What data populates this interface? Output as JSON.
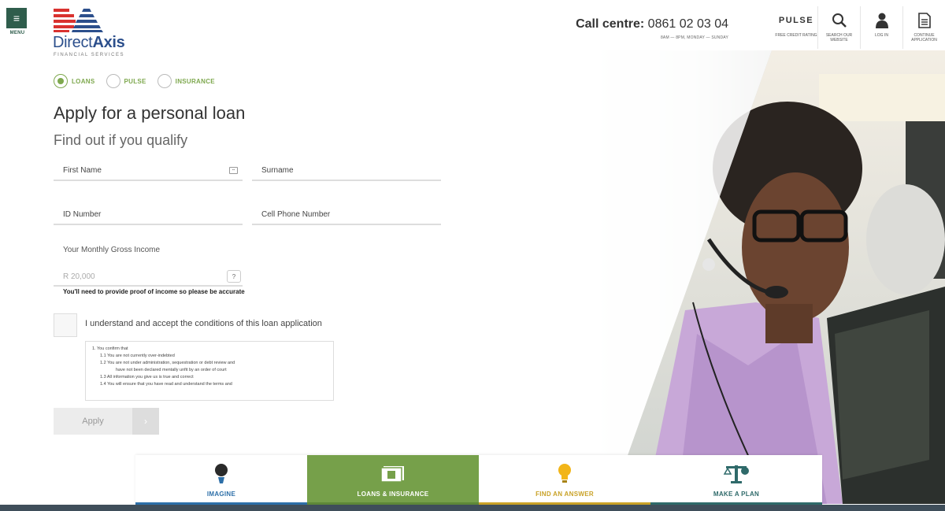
{
  "header": {
    "menu_label": "MENU",
    "logo_name_light": "Direct",
    "logo_name_bold": "Axis",
    "logo_sub": "FINANCIAL SERVICES",
    "call_centre_label": "Call centre:",
    "call_centre_number": "0861 02 03 04",
    "call_centre_hours": "8AM — 8PM, MONDAY — SUNDAY",
    "nav": [
      {
        "name": "pulse",
        "label": "FREE CREDIT RATING",
        "title": "PULSE"
      },
      {
        "name": "search",
        "label": "SEARCH OUR WEBSITE",
        "icon": "search-icon"
      },
      {
        "name": "login",
        "label": "LOG IN",
        "icon": "user-icon"
      },
      {
        "name": "continue",
        "label": "CONTINUE APPLICATION",
        "icon": "document-icon"
      }
    ]
  },
  "product_options": [
    {
      "label": "LOANS",
      "selected": true
    },
    {
      "label": "PULSE",
      "selected": false
    },
    {
      "label": "INSURANCE",
      "selected": false
    }
  ],
  "form": {
    "title": "Apply for a personal loan",
    "subtitle": "Find out if you qualify",
    "first_name_label": "First Name",
    "surname_label": "Surname",
    "id_number_label": "ID Number",
    "cell_phone_label": "Cell Phone Number",
    "income_label": "Your Monthly Gross Income",
    "income_placeholder": "R 20,000",
    "help_symbol": "?",
    "income_note": "You'll need to provide proof of income so please be accurate",
    "accept_label": "I understand and accept the conditions of this loan application",
    "terms": [
      {
        "level": 1,
        "text": "1.  You confirm that"
      },
      {
        "level": 2,
        "text": "1.1  You are not currently over-indebted"
      },
      {
        "level": 2,
        "text": "1.2  You are not under administration, sequestration or debt review and"
      },
      {
        "level": 3,
        "text": "have not been declared mentally unfit by an order of court"
      },
      {
        "level": 2,
        "text": "1.3  All information you give us is true and correct"
      },
      {
        "level": 2,
        "text": "1.4  You will ensure that you have read and understand the terms and"
      }
    ],
    "apply_label": "Apply",
    "apply_arrow": "›"
  },
  "bottom_nav": [
    {
      "label": "IMAGINE",
      "icon": "balloon-icon",
      "color": "#2d6fa8",
      "active": false
    },
    {
      "label": "LOANS & INSURANCE",
      "icon": "money-icon",
      "color": "#76a04a",
      "active": true
    },
    {
      "label": "FIND AN ANSWER",
      "icon": "lightbulb-icon",
      "color": "#c9a227",
      "active": false
    },
    {
      "label": "MAKE A PLAN",
      "icon": "scales-icon",
      "color": "#2f6a6a",
      "active": false
    }
  ],
  "colors": {
    "brand_green": "#76a04a",
    "brand_blue": "#2c4f8c",
    "brand_red": "#d9322f"
  }
}
